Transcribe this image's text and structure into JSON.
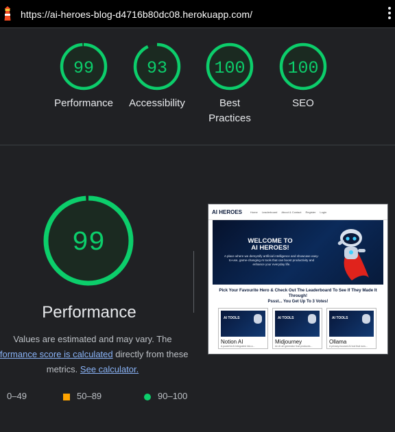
{
  "url_bar": {
    "url": "https://ai-heroes-blog-d4716b80dc08.herokuapp.com/"
  },
  "summary_gauges": [
    {
      "label": "Performance",
      "score": 99
    },
    {
      "label": "Accessibility",
      "score": 93
    },
    {
      "label_line1": "Best",
      "label_line2": "Practices",
      "score": 100
    },
    {
      "label": "SEO",
      "score": 100
    }
  ],
  "performance_detail": {
    "score": 99,
    "title": "Performance",
    "desc_line1": "Values are estimated and may vary. The",
    "desc_link1": "rformance score is calculated",
    "desc_line2_rest": " directly from these",
    "desc_line3_pre": "metrics. ",
    "desc_link2": "See calculator."
  },
  "legend": [
    {
      "range": "0–49",
      "color": "#ff4e42"
    },
    {
      "range": "50–89",
      "color": "#ffa400"
    },
    {
      "range": "90–100",
      "color": "#0cce6b"
    }
  ],
  "colors": {
    "pass": "#0cce6b",
    "track": "#1f3b2a",
    "fill": "#1b2a21",
    "link": "#8ab4f8"
  },
  "thumbnail": {
    "brand": "AI HEROES",
    "nav_links": [
      "Home",
      "Leaderboard",
      "About & Contact",
      "Register",
      "Login"
    ],
    "hero_title_line1": "WELCOME TO",
    "hero_title_line2": "AI HEROES!",
    "hero_sub": "A place where we demystify artificial intelligence and showcase easy-to-use, game-changing AI tools that can boost productivity and enhance your everyday life.",
    "cta_line1": "Pick Your Favourite Hero & Check Out The Leaderboard To See If They Made It",
    "cta_line2": "Through!",
    "cta_line3": "Pssst... You Get Up To 3 Votes!",
    "card_tag": "AI TOOLS",
    "cards": [
      {
        "name": "Notion AI",
        "desc": "A powerful AI integrated into a..."
      },
      {
        "name": "Midjourney",
        "desc": "An AI art generator that produces..."
      },
      {
        "name": "Ollama",
        "desc": "A privacy-focused AI tool that runs..."
      }
    ]
  }
}
